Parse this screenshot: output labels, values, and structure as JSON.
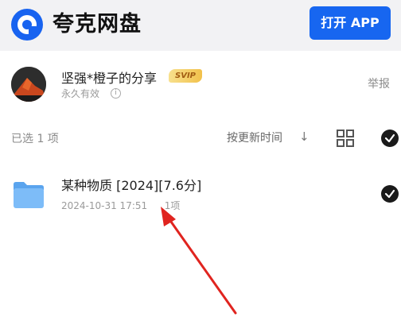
{
  "header": {
    "brand": "夸克网盘",
    "open_app_label": "打开 APP"
  },
  "sharer": {
    "name": "坚强*橙子的分享",
    "badge": "SVIP",
    "validity": "永久有效",
    "report_label": "举报"
  },
  "selection": {
    "count_label": "已选 1 项",
    "sort_label": "按更新时间",
    "sort_arrow": "↓"
  },
  "files": [
    {
      "name": "某种物质 [2024][7.6分]",
      "date": "2024-10-31 17:51",
      "items": "1项",
      "icon": "folder-icon"
    }
  ],
  "colors": {
    "brand_blue": "#1766f0",
    "annotation_arrow": "#e0241f"
  }
}
